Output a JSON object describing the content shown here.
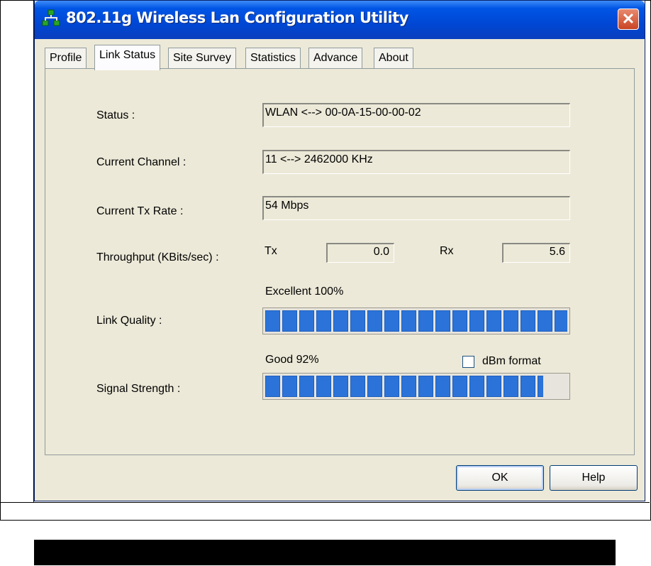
{
  "window": {
    "title": "802.11g Wireless Lan Configuration Utility"
  },
  "tabs": [
    {
      "label": "Profile"
    },
    {
      "label": "Link Status"
    },
    {
      "label": "Site Survey"
    },
    {
      "label": "Statistics"
    },
    {
      "label": "Advance"
    },
    {
      "label": "About"
    }
  ],
  "active_tab": "Link Status",
  "status": {
    "label": "Status :",
    "value": "WLAN <--> 00-0A-15-00-00-02"
  },
  "channel": {
    "label": "Current Channel :",
    "value": "11 <--> 2462000 KHz"
  },
  "tx_rate": {
    "label": "Current Tx Rate :",
    "value": "54 Mbps"
  },
  "throughput": {
    "label": "Throughput (KBits/sec) :",
    "tx_label": "Tx",
    "tx_value": "0.0",
    "rx_label": "Rx",
    "rx_value": "5.6"
  },
  "link_quality": {
    "label": "Link Quality :",
    "text": "Excellent 100%",
    "level": 100
  },
  "signal_strength": {
    "label": "Signal Strength :",
    "text": "Good 92%",
    "level": 92
  },
  "dbm_format": {
    "label": "dBm format",
    "checked": false
  },
  "buttons": {
    "ok": "OK",
    "help": "Help"
  },
  "colors": {
    "titlebar": "#0055e5",
    "bar_fill": "#2b73d8",
    "dialog_bg": "#ece9d8"
  }
}
